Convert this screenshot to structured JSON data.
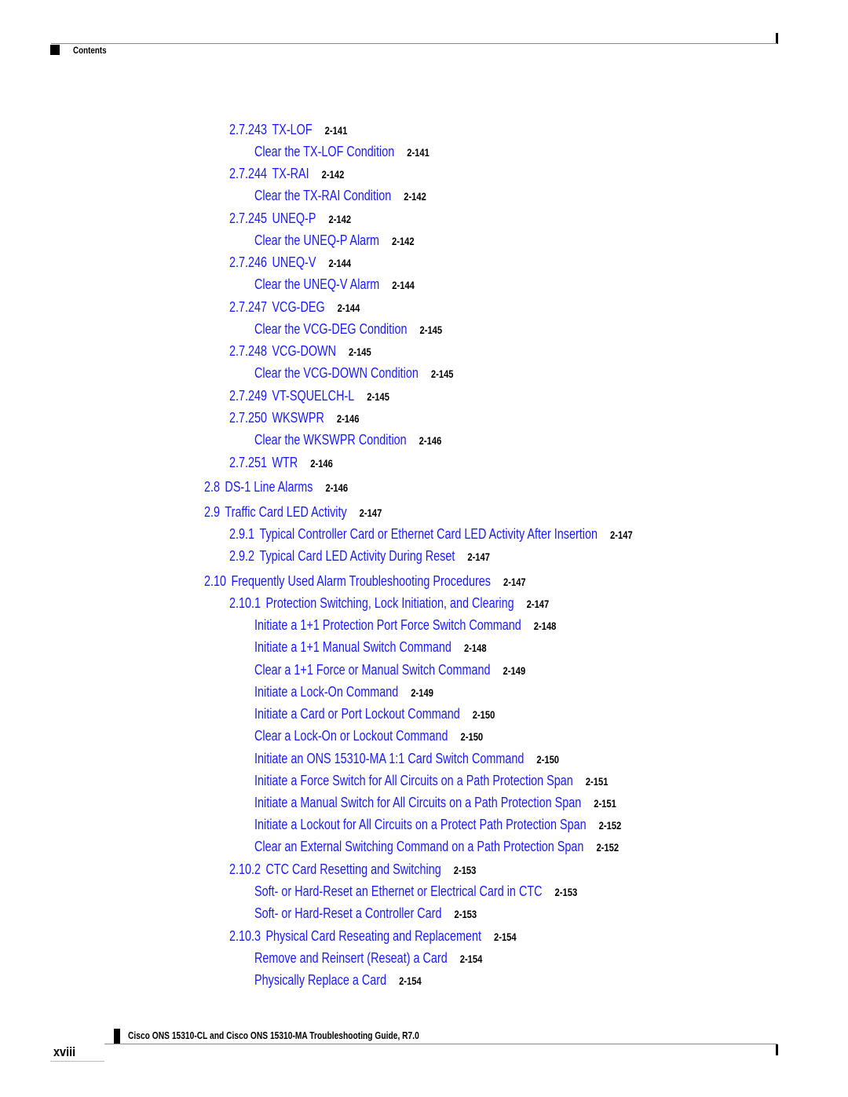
{
  "header": {
    "section_title": "Contents"
  },
  "toc": [
    {
      "level": 1,
      "num": "2.7.243",
      "title": "TX-LOF",
      "page": "2-141"
    },
    {
      "level": 2,
      "num": "",
      "title": "Clear the TX-LOF Condition",
      "page": "2-141"
    },
    {
      "level": 1,
      "num": "2.7.244",
      "title": "TX-RAI",
      "page": "2-142"
    },
    {
      "level": 2,
      "num": "",
      "title": "Clear the TX-RAI Condition",
      "page": "2-142"
    },
    {
      "level": 1,
      "num": "2.7.245",
      "title": "UNEQ-P",
      "page": "2-142"
    },
    {
      "level": 2,
      "num": "",
      "title": "Clear the UNEQ-P Alarm",
      "page": "2-142"
    },
    {
      "level": 1,
      "num": "2.7.246",
      "title": "UNEQ-V",
      "page": "2-144"
    },
    {
      "level": 2,
      "num": "",
      "title": "Clear the UNEQ-V Alarm",
      "page": "2-144"
    },
    {
      "level": 1,
      "num": "2.7.247",
      "title": "VCG-DEG",
      "page": "2-144"
    },
    {
      "level": 2,
      "num": "",
      "title": "Clear the VCG-DEG Condition",
      "page": "2-145"
    },
    {
      "level": 1,
      "num": "2.7.248",
      "title": "VCG-DOWN",
      "page": "2-145"
    },
    {
      "level": 2,
      "num": "",
      "title": "Clear the VCG-DOWN Condition",
      "page": "2-145"
    },
    {
      "level": 1,
      "num": "2.7.249",
      "title": "VT-SQUELCH-L",
      "page": "2-145"
    },
    {
      "level": 1,
      "num": "2.7.250",
      "title": "WKSWPR",
      "page": "2-146"
    },
    {
      "level": 2,
      "num": "",
      "title": "Clear the WKSWPR Condition",
      "page": "2-146"
    },
    {
      "level": 1,
      "num": "2.7.251",
      "title": "WTR",
      "page": "2-146"
    },
    {
      "level": 0,
      "num": "2.8",
      "title": "DS-1 Line Alarms",
      "page": "2-146"
    },
    {
      "level": 0,
      "num": "2.9",
      "title": "Traffic Card LED Activity",
      "page": "2-147"
    },
    {
      "level": 1,
      "num": "2.9.1",
      "title": "Typical Controller Card or Ethernet Card LED Activity After Insertion",
      "page": "2-147"
    },
    {
      "level": 1,
      "num": "2.9.2",
      "title": "Typical Card LED Activity During Reset",
      "page": "2-147"
    },
    {
      "level": 0,
      "num": "2.10",
      "title": "Frequently Used Alarm Troubleshooting Procedures",
      "page": "2-147"
    },
    {
      "level": 1,
      "num": "2.10.1",
      "title": "Protection Switching, Lock Initiation, and Clearing",
      "page": "2-147"
    },
    {
      "level": 2,
      "num": "",
      "title": "Initiate a 1+1 Protection Port Force Switch Command",
      "page": "2-148"
    },
    {
      "level": 2,
      "num": "",
      "title": "Initiate a 1+1 Manual Switch Command",
      "page": "2-148"
    },
    {
      "level": 2,
      "num": "",
      "title": "Clear a 1+1 Force or Manual Switch Command",
      "page": "2-149"
    },
    {
      "level": 2,
      "num": "",
      "title": "Initiate a Lock-On Command",
      "page": "2-149"
    },
    {
      "level": 2,
      "num": "",
      "title": "Initiate a Card or Port Lockout Command",
      "page": "2-150"
    },
    {
      "level": 2,
      "num": "",
      "title": "Clear a Lock-On or Lockout Command",
      "page": "2-150"
    },
    {
      "level": 2,
      "num": "",
      "title": "Initiate an ONS 15310-MA 1:1 Card Switch Command",
      "page": "2-150"
    },
    {
      "level": 2,
      "num": "",
      "title": "Initiate a Force Switch for All Circuits on a Path Protection Span",
      "page": "2-151"
    },
    {
      "level": 2,
      "num": "",
      "title": "Initiate a Manual Switch for All Circuits on a Path Protection Span",
      "page": "2-151"
    },
    {
      "level": 2,
      "num": "",
      "title": "Initiate a Lockout for All Circuits on a Protect Path Protection Span",
      "page": "2-152"
    },
    {
      "level": 2,
      "num": "",
      "title": "Clear an External Switching Command on a Path Protection Span",
      "page": "2-152"
    },
    {
      "level": 1,
      "num": "2.10.2",
      "title": "CTC Card Resetting and Switching",
      "page": "2-153"
    },
    {
      "level": 2,
      "num": "",
      "title": "Soft- or Hard-Reset an Ethernet or Electrical Card in CTC",
      "page": "2-153"
    },
    {
      "level": 2,
      "num": "",
      "title": "Soft- or Hard-Reset a Controller Card",
      "page": "2-153"
    },
    {
      "level": 1,
      "num": "2.10.3",
      "title": "Physical Card Reseating and Replacement",
      "page": "2-154"
    },
    {
      "level": 2,
      "num": "",
      "title": "Remove and Reinsert (Reseat) a Card",
      "page": "2-154"
    },
    {
      "level": 2,
      "num": "",
      "title": "Physically Replace a Card",
      "page": "2-154"
    }
  ],
  "footer": {
    "doc_title": "Cisco ONS 15310-CL and Cisco ONS 15310-MA Troubleshooting Guide, R7.0",
    "page_number": "xviii"
  },
  "colors": {
    "link": "#1a1aff",
    "page_ref": "#000000"
  }
}
